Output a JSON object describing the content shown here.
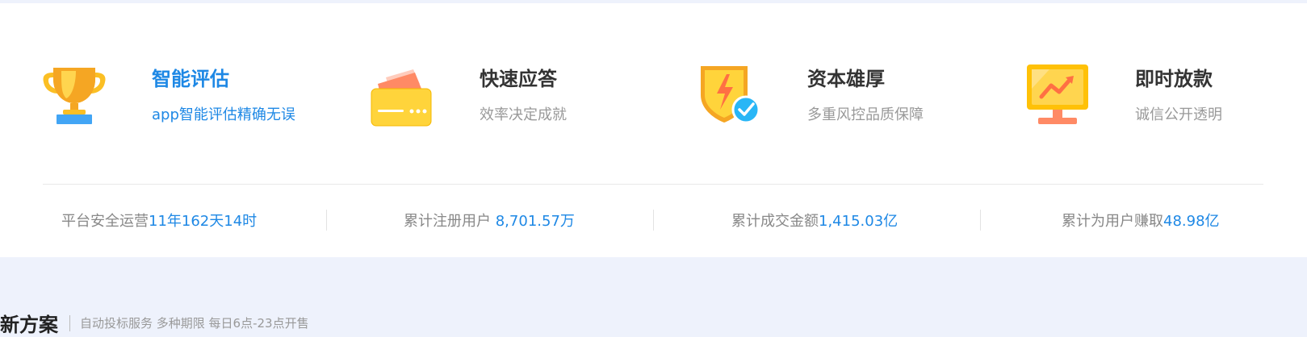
{
  "features": [
    {
      "title": "智能评估",
      "subtitle": "app智能评估精确无误",
      "icon": "trophy-icon"
    },
    {
      "title": "快速应答",
      "subtitle": "效率决定成就",
      "icon": "card-icon"
    },
    {
      "title": "资本雄厚",
      "subtitle": "多重风控品质保障",
      "icon": "shield-icon"
    },
    {
      "title": "即时放款",
      "subtitle": "诚信公开透明",
      "icon": "monitor-chart-icon"
    }
  ],
  "stats": [
    {
      "label": "平台安全运营",
      "value": "11年162天14时"
    },
    {
      "label": "累计注册用户",
      "value": "8,701.57万"
    },
    {
      "label": "累计成交金额",
      "value": "1,415.03亿"
    },
    {
      "label": "累计为用户赚取",
      "value": "48.98亿"
    }
  ],
  "section": {
    "title": "新方案",
    "desc": "自动投标服务 多种期限 每日6点-23点开售"
  },
  "colors": {
    "accent": "#1e88e5",
    "background": "#eef2fc"
  }
}
